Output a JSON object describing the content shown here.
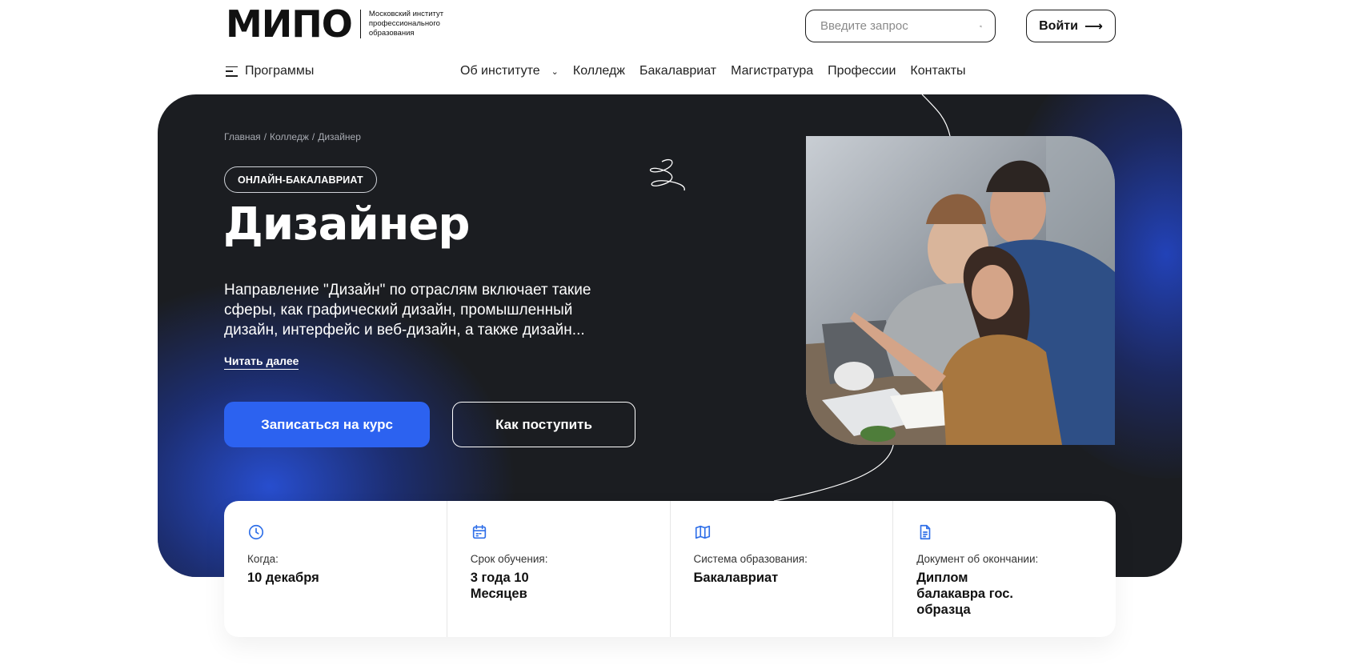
{
  "header": {
    "logo": "МИПО",
    "logo_subtitle": "Московский институт профессионального образования",
    "search_placeholder": "Введите запрос",
    "login_label": "Войти"
  },
  "nav": {
    "programs_label": "Программы",
    "links": [
      {
        "label": "Об институте",
        "has_dropdown": true
      },
      {
        "label": "Колледж"
      },
      {
        "label": "Бакалавриат"
      },
      {
        "label": "Магистратура"
      },
      {
        "label": "Профессии"
      },
      {
        "label": "Контакты"
      }
    ]
  },
  "hero": {
    "breadcrumb": [
      "Главная",
      "/",
      "Колледж",
      "/",
      "Дизайнер"
    ],
    "badge": "ОНЛАЙН-БАКАЛАВРИАТ",
    "title": "Дизайнер",
    "description": "Направление \"Дизайн\" по отраслям включает такие сферы, как графический дизайн, промышленный дизайн, интерфейс и веб-дизайн, а также дизайн...",
    "read_more": "Читать далее",
    "primary_button": "Записаться на курс",
    "secondary_button": "Как поступить"
  },
  "info_cards": [
    {
      "icon": "clock-icon",
      "label": "Когда:",
      "value": "10 декабря"
    },
    {
      "icon": "calendar-icon",
      "label": "Срок обучения:",
      "value": "3 года 10 Месяцев"
    },
    {
      "icon": "map-icon",
      "label": "Система образования:",
      "value": "Бакалавриат"
    },
    {
      "icon": "document-icon",
      "label": "Документ об окончании:",
      "value": "Диплом балакавра гос. образца"
    }
  ],
  "colors": {
    "hero_bg": "#1b1d21",
    "accent_blue": "#2c62f0",
    "icon_blue": "#2f6fe8"
  }
}
